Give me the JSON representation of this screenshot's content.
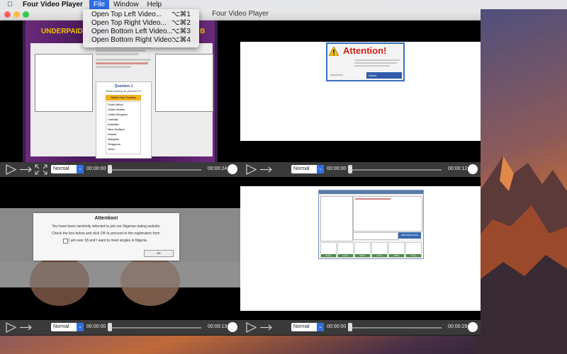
{
  "menubar": {
    "app_name": "Four Video Player",
    "menus": [
      "File",
      "Window",
      "Help"
    ]
  },
  "file_menu": {
    "items": [
      {
        "label": "Open Top Left Video...",
        "shortcut": "⌥⌘1"
      },
      {
        "label": "Open Top Right Video...",
        "shortcut": "⌥⌘2"
      },
      {
        "label": "Open Bottom Left Video...",
        "shortcut": "⌥⌘3"
      },
      {
        "label": "Open Bottom Right Video...",
        "shortcut": "⌥⌘4"
      }
    ]
  },
  "window": {
    "title": "Four Video Player"
  },
  "players": [
    {
      "speed": "Normal",
      "current_time": "00:00:00",
      "duration": "00:00:24"
    },
    {
      "speed": "Normal",
      "current_time": "00:00:00",
      "duration": "00:00:12"
    },
    {
      "speed": "Normal",
      "current_time": "00:00:00",
      "duration": "00:00:13"
    },
    {
      "speed": "Normal",
      "current_time": "00:00:00",
      "duration": "00:00:29"
    }
  ],
  "video_tl": {
    "banner": "UNDERPAID?",
    "banner_end": "B",
    "question": "Question 1",
    "question_text": "What country do you live in?",
    "select_label": "Select Your Country",
    "countries": [
      "South Africa",
      "United States",
      "United Kingdom",
      "Canada",
      "Australia",
      "New Zealand",
      "Ireland",
      "Malaysia",
      "Singapore",
      "Other"
    ]
  },
  "video_tr": {
    "heading": "Attention!",
    "select_value": "Select"
  },
  "video_bl": {
    "heading": "Attention!",
    "line1": "You have been randomly selected to join our Nigerian dating website.",
    "line2": "Check the box below and click OK to proceed to the registration form.",
    "checkbox_label": "I am over 18 and I want to meet singles in Nigeria.",
    "ok_label": "OK"
  },
  "video_br": {
    "register_label": "REGISTER NOW",
    "status_labels": [
      "Online",
      "Online",
      "Offline",
      "Online",
      "Offline",
      "Online"
    ]
  },
  "colors": {
    "accent": "#2f6fe0",
    "attention_red": "#d0201a"
  }
}
